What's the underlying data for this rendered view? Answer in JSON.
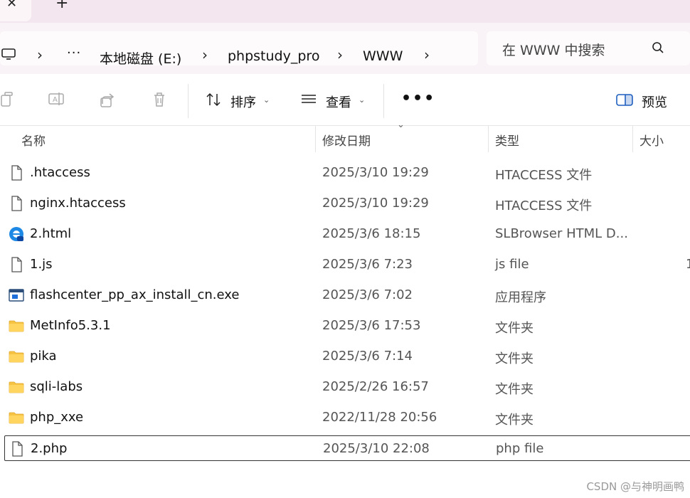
{
  "window": {
    "tab_close": "✕",
    "tab_new": "+",
    "controls": [
      "—",
      "▢",
      "✕"
    ]
  },
  "address": {
    "overflow": "···",
    "crumbs": [
      "本地磁盘 (E:)",
      "phpstudy_pro",
      "WWW"
    ],
    "chevron": "›",
    "search_placeholder": "在 WWW 中搜索"
  },
  "toolbar": {
    "sort_label": "排序",
    "view_label": "查看",
    "more": "•••",
    "preview_label": "预览",
    "caret": "⌄"
  },
  "columns": {
    "name": "名称",
    "date": "修改日期",
    "type": "类型",
    "size": "大小",
    "sort_caret": "⌄"
  },
  "files": [
    {
      "icon": "file-icon",
      "name": ".htaccess",
      "date": "2025/3/10 19:29",
      "type": "HTACCESS 文件",
      "size": ""
    },
    {
      "icon": "file-icon",
      "name": "nginx.htaccess",
      "date": "2025/3/10 19:29",
      "type": "HTACCESS 文件",
      "size": ""
    },
    {
      "icon": "browser-icon",
      "name": "2.html",
      "date": "2025/3/6 18:15",
      "type": "SLBrowser HTML D...",
      "size": ""
    },
    {
      "icon": "file-icon",
      "name": "1.js",
      "date": "2025/3/6 7:23",
      "type": "js file",
      "size": "1"
    },
    {
      "icon": "exe-icon",
      "name": "flashcenter_pp_ax_install_cn.exe",
      "date": "2025/3/6 7:02",
      "type": "应用程序",
      "size": ""
    },
    {
      "icon": "folder-icon",
      "name": "MetInfo5.3.1",
      "date": "2025/3/6 17:53",
      "type": "文件夹",
      "size": ""
    },
    {
      "icon": "folder-icon",
      "name": "pika",
      "date": "2025/3/6 7:14",
      "type": "文件夹",
      "size": ""
    },
    {
      "icon": "folder-icon",
      "name": "sqli-labs",
      "date": "2025/2/26 16:57",
      "type": "文件夹",
      "size": ""
    },
    {
      "icon": "folder-icon",
      "name": "php_xxe",
      "date": "2022/11/28 20:56",
      "type": "文件夹",
      "size": ""
    },
    {
      "icon": "file-icon",
      "name": "2.php",
      "date": "2025/3/10 22:08",
      "type": "php file",
      "size": "",
      "selected": true
    }
  ],
  "watermark": "CSDN @与神明画鸭"
}
